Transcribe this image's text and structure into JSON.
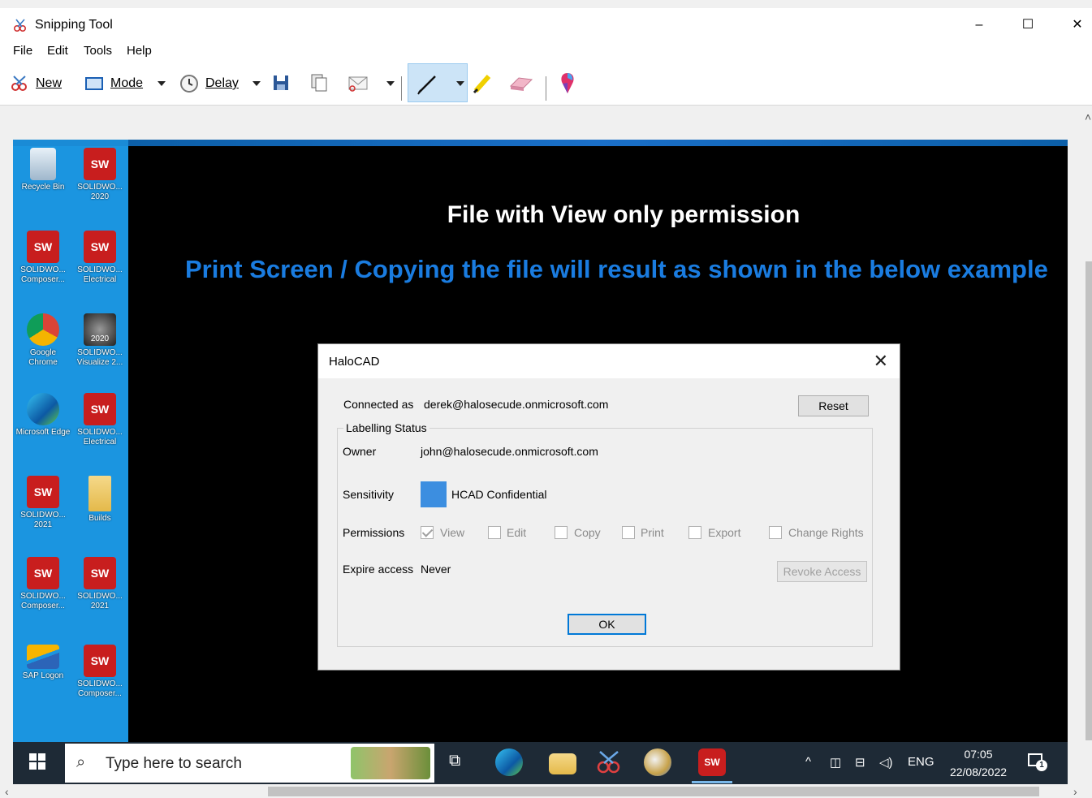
{
  "window": {
    "title": "Snipping Tool",
    "minimize": "–",
    "maximize": "☐",
    "close": "✕"
  },
  "menu": [
    "File",
    "Edit",
    "Tools",
    "Help"
  ],
  "toolbar": {
    "new": "New",
    "mode": "Mode",
    "delay": "Delay"
  },
  "capture": {
    "headline": "File with View only permission",
    "subheadline": "Print Screen / Copying the file will result as shown in the below example",
    "desktop_icons": [
      {
        "label": "Recycle Bin"
      },
      {
        "label": "SOLIDWO... 2020",
        "badge": "SW"
      },
      {
        "label": "SOLIDWO... Composer...",
        "badge": "SW"
      },
      {
        "label": "SOLIDWO... Electrical",
        "badge": "SW"
      },
      {
        "label": "Google Chrome"
      },
      {
        "label": "SOLIDWO... Visualize 2...",
        "badge": "2020"
      },
      {
        "label": "Microsoft Edge"
      },
      {
        "label": "SOLIDWO... Electrical",
        "badge": "SW"
      },
      {
        "label": "SOLIDWO... 2021",
        "badge": "SW"
      },
      {
        "label": "Builds"
      },
      {
        "label": "SOLIDWO... Composer...",
        "badge": "SW"
      },
      {
        "label": "SOLIDWO... 2021",
        "badge": "SW"
      },
      {
        "label": "SAP Logon"
      },
      {
        "label": "SOLIDWO... Composer...",
        "badge": "SW"
      }
    ],
    "taskbar": {
      "search_placeholder": "Type here to search",
      "tray_lang": "ENG",
      "time": "07:05",
      "date": "22/08/2022",
      "notifications": "1"
    }
  },
  "dialog": {
    "title": "HaloCAD",
    "connected_label": "Connected as",
    "connected_value": "derek@halosecude.onmicrosoft.com",
    "reset_button": "Reset",
    "group_label": "Labelling Status",
    "owner_label": "Owner",
    "owner_value": "john@halosecude.onmicrosoft.com",
    "sensitivity_label": "Sensitivity",
    "sensitivity_value": "HCAD Confidential",
    "sensitivity_color": "#3c8ee0",
    "permissions_label": "Permissions",
    "permissions": [
      {
        "label": "View",
        "checked": true
      },
      {
        "label": "Edit",
        "checked": false
      },
      {
        "label": "Copy",
        "checked": false
      },
      {
        "label": "Print",
        "checked": false
      },
      {
        "label": "Export",
        "checked": false
      },
      {
        "label": "Change Rights",
        "checked": false
      }
    ],
    "expire_label": "Expire access",
    "expire_value": "Never",
    "revoke_button": "Revoke Access",
    "ok_button": "OK"
  }
}
